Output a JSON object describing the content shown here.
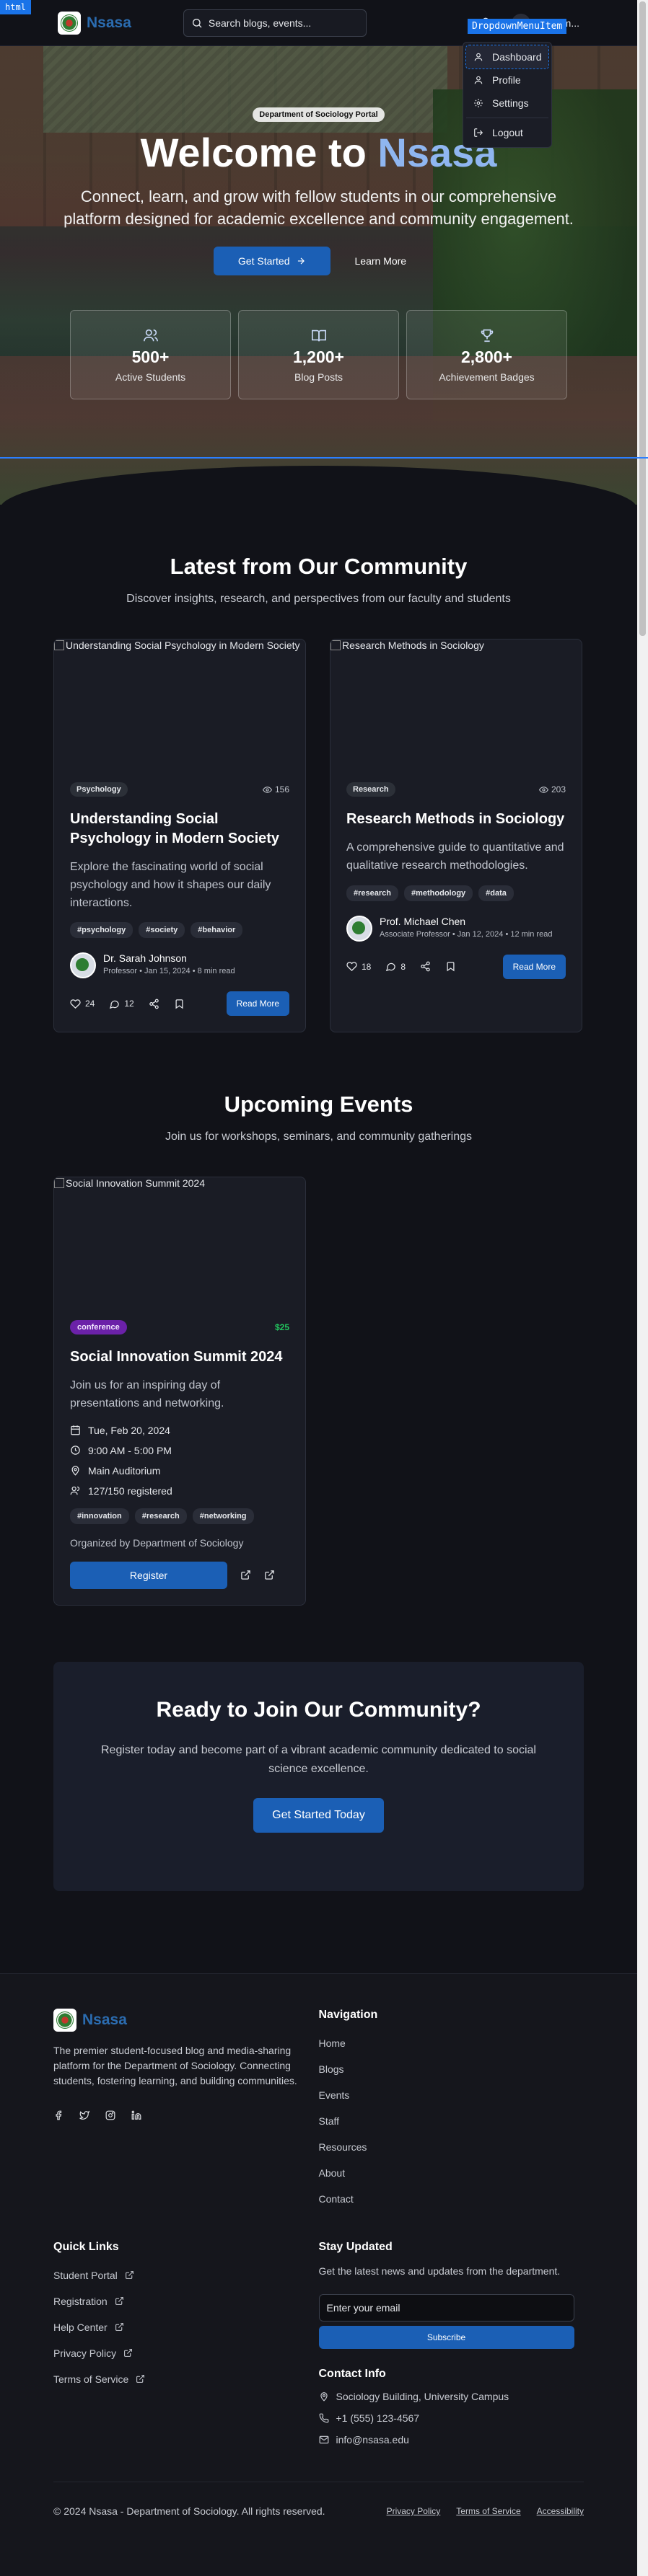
{
  "debug": {
    "html_tag": "html",
    "dropdown_tag": "DropdownMenuItem"
  },
  "header": {
    "brand": "Nsasa",
    "search_placeholder": "Search blogs, events...",
    "user_initial": "S",
    "user_name": "System..."
  },
  "dropdown": {
    "items": [
      {
        "label": "Dashboard",
        "icon": "user-icon"
      },
      {
        "label": "Profile",
        "icon": "user-icon"
      },
      {
        "label": "Settings",
        "icon": "gear-icon"
      },
      {
        "label": "Logout",
        "icon": "logout-icon"
      }
    ]
  },
  "hero": {
    "badge": "Department of Sociology Portal",
    "title_prefix": "Welcome to",
    "title_accent": "Nsasa",
    "subtitle": "Connect, learn, and grow with fellow students in our comprehensive platform designed for academic excellence and community engagement.",
    "cta_primary": "Get Started",
    "cta_secondary": "Learn More",
    "stats": [
      {
        "value": "500+",
        "label": "Active Students",
        "icon": "users-icon"
      },
      {
        "value": "1,200+",
        "label": "Blog Posts",
        "icon": "book-icon"
      },
      {
        "value": "2,800+",
        "label": "Achievement Badges",
        "icon": "trophy-icon"
      }
    ]
  },
  "community": {
    "title": "Latest from Our Community",
    "subtitle": "Discover insights, research, and perspectives from our faculty and students",
    "posts": [
      {
        "image_alt": "Understanding Social Psychology in Modern Society",
        "category": "Psychology",
        "views": "156",
        "title": "Understanding Social Psychology in Modern Society",
        "excerpt": "Explore the fascinating world of social psychology and how it shapes our daily interactions.",
        "tags": [
          "#psychology",
          "#society",
          "#behavior"
        ],
        "author": "Dr. Sarah Johnson",
        "author_meta": "Professor • Jan 15, 2024 • 8 min read",
        "likes": "24",
        "comments": "12",
        "read_more": "Read More"
      },
      {
        "image_alt": "Research Methods in Sociology",
        "category": "Research",
        "views": "203",
        "title": "Research Methods in Sociology",
        "excerpt": "A comprehensive guide to quantitative and qualitative research methodologies.",
        "tags": [
          "#research",
          "#methodology",
          "#data"
        ],
        "author": "Prof. Michael Chen",
        "author_meta": "Associate Professor • Jan 12, 2024 • 12 min read",
        "likes": "18",
        "comments": "8",
        "read_more": "Read More"
      }
    ]
  },
  "events": {
    "title": "Upcoming Events",
    "subtitle": "Join us for workshops, seminars, and community gatherings",
    "items": [
      {
        "image_alt": "Social Innovation Summit 2024",
        "type": "conference",
        "price": "$25",
        "title": "Social Innovation Summit 2024",
        "description": "Join us for an inspiring day of presentations and networking.",
        "date": "Tue, Feb 20, 2024",
        "time": "9:00 AM - 5:00 PM",
        "location": "Main Auditorium",
        "registered": "127/150 registered",
        "tags": [
          "#innovation",
          "#research",
          "#networking"
        ],
        "organizer": "Organized by Department of Sociology",
        "register_label": "Register"
      }
    ]
  },
  "cta": {
    "title": "Ready to Join Our Community?",
    "text": "Register today and become part of a vibrant academic community dedicated to social science excellence.",
    "button": "Get Started Today"
  },
  "footer": {
    "brand": "Nsasa",
    "description": "The premier student-focused blog and media-sharing platform for the Department of Sociology. Connecting students, fostering learning, and building communities.",
    "socials": [
      "facebook-icon",
      "twitter-icon",
      "instagram-icon",
      "linkedin-icon"
    ],
    "nav_title": "Navigation",
    "nav_links": [
      "Home",
      "Blogs",
      "Events",
      "Staff",
      "Resources",
      "About",
      "Contact"
    ],
    "quick_title": "Quick Links",
    "quick_links": [
      "Student Portal",
      "Registration",
      "Help Center",
      "Privacy Policy",
      "Terms of Service"
    ],
    "newsletter_title": "Stay Updated",
    "newsletter_text": "Get the latest news and updates from the department.",
    "email_placeholder": "Enter your email",
    "subscribe_label": "Subscribe",
    "contact_title": "Contact Info",
    "contact": {
      "address": "Sociology Building, University Campus",
      "phone": "+1 (555) 123-4567",
      "email": "info@nsasa.edu"
    },
    "copyright": "© 2024 Nsasa - Department of Sociology. All rights reserved.",
    "legal": [
      "Privacy Policy",
      "Terms of Service",
      "Accessibility"
    ]
  },
  "colors": {
    "accent": "#1b5fb5",
    "brand": "#2b6cb0",
    "background": "#111218",
    "event_chip": "#6b21a8",
    "price": "#22c55e"
  }
}
